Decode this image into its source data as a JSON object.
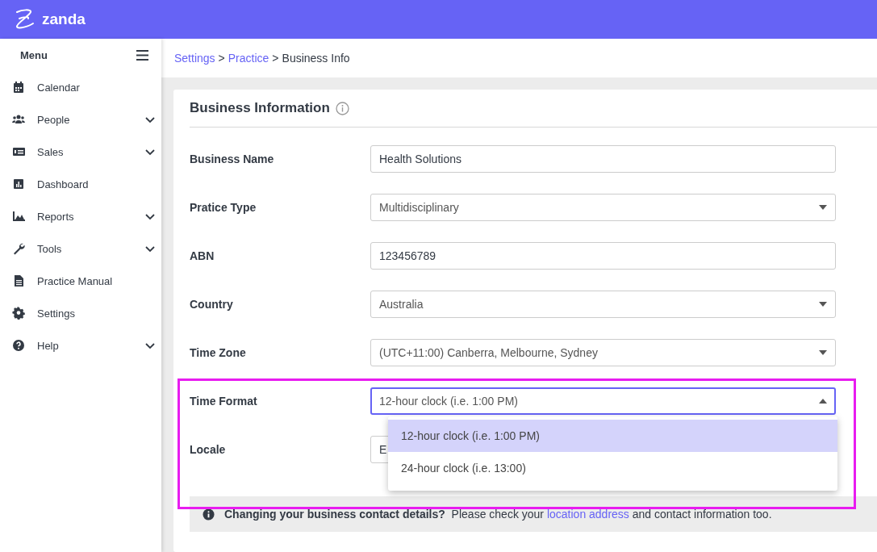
{
  "app": {
    "logo": "zanda"
  },
  "sidebar": {
    "title": "Menu",
    "items": [
      {
        "label": "Calendar",
        "expandable": false
      },
      {
        "label": "People",
        "expandable": true
      },
      {
        "label": "Sales",
        "expandable": true
      },
      {
        "label": "Dashboard",
        "expandable": false
      },
      {
        "label": "Reports",
        "expandable": true
      },
      {
        "label": "Tools",
        "expandable": true
      },
      {
        "label": "Practice Manual",
        "expandable": false
      },
      {
        "label": "Settings",
        "expandable": false
      },
      {
        "label": "Help",
        "expandable": true
      }
    ]
  },
  "breadcrumb": [
    {
      "label": "Settings",
      "link": true
    },
    {
      "separator": ">",
      "label": "Practice",
      "link": true
    },
    {
      "separator": ">",
      "label": "Business Info",
      "link": false
    }
  ],
  "card": {
    "title": "Business Information",
    "fields": [
      {
        "label": "Business Name",
        "kind": "text",
        "value": "Health Solutions"
      },
      {
        "label": "Pratice Type",
        "kind": "select",
        "value": "Multidisciplinary",
        "open": false
      },
      {
        "label": "ABN",
        "kind": "text",
        "value": "123456789"
      },
      {
        "label": "Country",
        "kind": "select",
        "value": "Australia",
        "open": false
      },
      {
        "label": "Time Zone",
        "kind": "select",
        "value": "(UTC+11:00) Canberra, Melbourne, Sydney",
        "open": false
      },
      {
        "label": "Time Format",
        "kind": "select",
        "value": "12-hour clock (i.e. 1:00 PM)",
        "open": true,
        "options": [
          {
            "label": "12-hour clock (i.e. 1:00 PM)",
            "selected": true
          },
          {
            "label": "24-hour clock (i.e. 13:00)",
            "selected": false
          }
        ]
      },
      {
        "label": "Locale",
        "kind": "text",
        "value": "E"
      }
    ],
    "notice": {
      "lead": "Changing your business contact details?",
      "before": "Please check your",
      "link": "location address",
      "after": "and contact information too."
    }
  },
  "highlight": true
}
